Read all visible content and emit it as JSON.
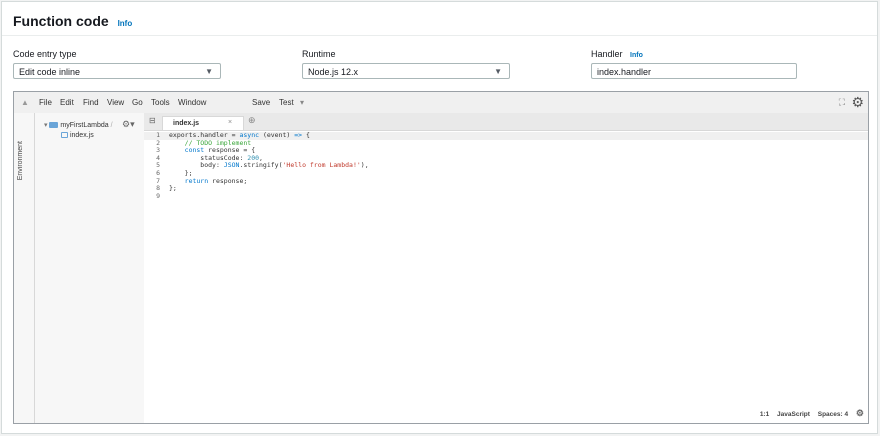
{
  "section": {
    "title": "Function code",
    "info": "Info"
  },
  "fields": {
    "code_entry": {
      "label": "Code entry type",
      "value": "Edit code inline"
    },
    "runtime": {
      "label": "Runtime",
      "value": "Node.js 12.x"
    },
    "handler": {
      "label": "Handler",
      "info": "Info",
      "value": "index.handler"
    }
  },
  "ide": {
    "menu": [
      "File",
      "Edit",
      "Find",
      "View",
      "Go",
      "Tools",
      "Window"
    ],
    "save": "Save",
    "test": "Test",
    "env_label": "Environment",
    "tree": {
      "folder": "myFirstLambda",
      "file": "index.js"
    },
    "tab": "index.js",
    "status": {
      "position": "1:1",
      "language": "JavaScript",
      "spaces": "Spaces: 4"
    }
  },
  "code_lines": [
    {
      "n": "1",
      "parts": [
        [
          "",
          "exports.handler = "
        ],
        [
          "kw",
          "async"
        ],
        [
          "",
          " (event) "
        ],
        [
          "kw",
          "=>"
        ],
        [
          "",
          " {"
        ]
      ]
    },
    {
      "n": "2",
      "parts": [
        [
          "",
          "    "
        ],
        [
          "cm",
          "// TODO implement"
        ]
      ]
    },
    {
      "n": "3",
      "parts": [
        [
          "",
          "    "
        ],
        [
          "kw",
          "const"
        ],
        [
          "",
          " response = {"
        ]
      ]
    },
    {
      "n": "4",
      "parts": [
        [
          "",
          "        statusCode: "
        ],
        [
          "num",
          "200"
        ],
        [
          "",
          ","
        ]
      ]
    },
    {
      "n": "5",
      "parts": [
        [
          "",
          "        body: "
        ],
        [
          "kw",
          "JSON"
        ],
        [
          "",
          ".stringify("
        ],
        [
          "str",
          "'Hello from Lambda!'"
        ],
        [
          "",
          "),"
        ]
      ]
    },
    {
      "n": "6",
      "parts": [
        [
          "",
          "    };"
        ]
      ]
    },
    {
      "n": "7",
      "parts": [
        [
          "",
          "    "
        ],
        [
          "kw",
          "return"
        ],
        [
          "",
          " response;"
        ]
      ]
    },
    {
      "n": "8",
      "parts": [
        [
          "",
          "};"
        ]
      ]
    },
    {
      "n": "9",
      "parts": [
        [
          "",
          ""
        ]
      ]
    }
  ]
}
